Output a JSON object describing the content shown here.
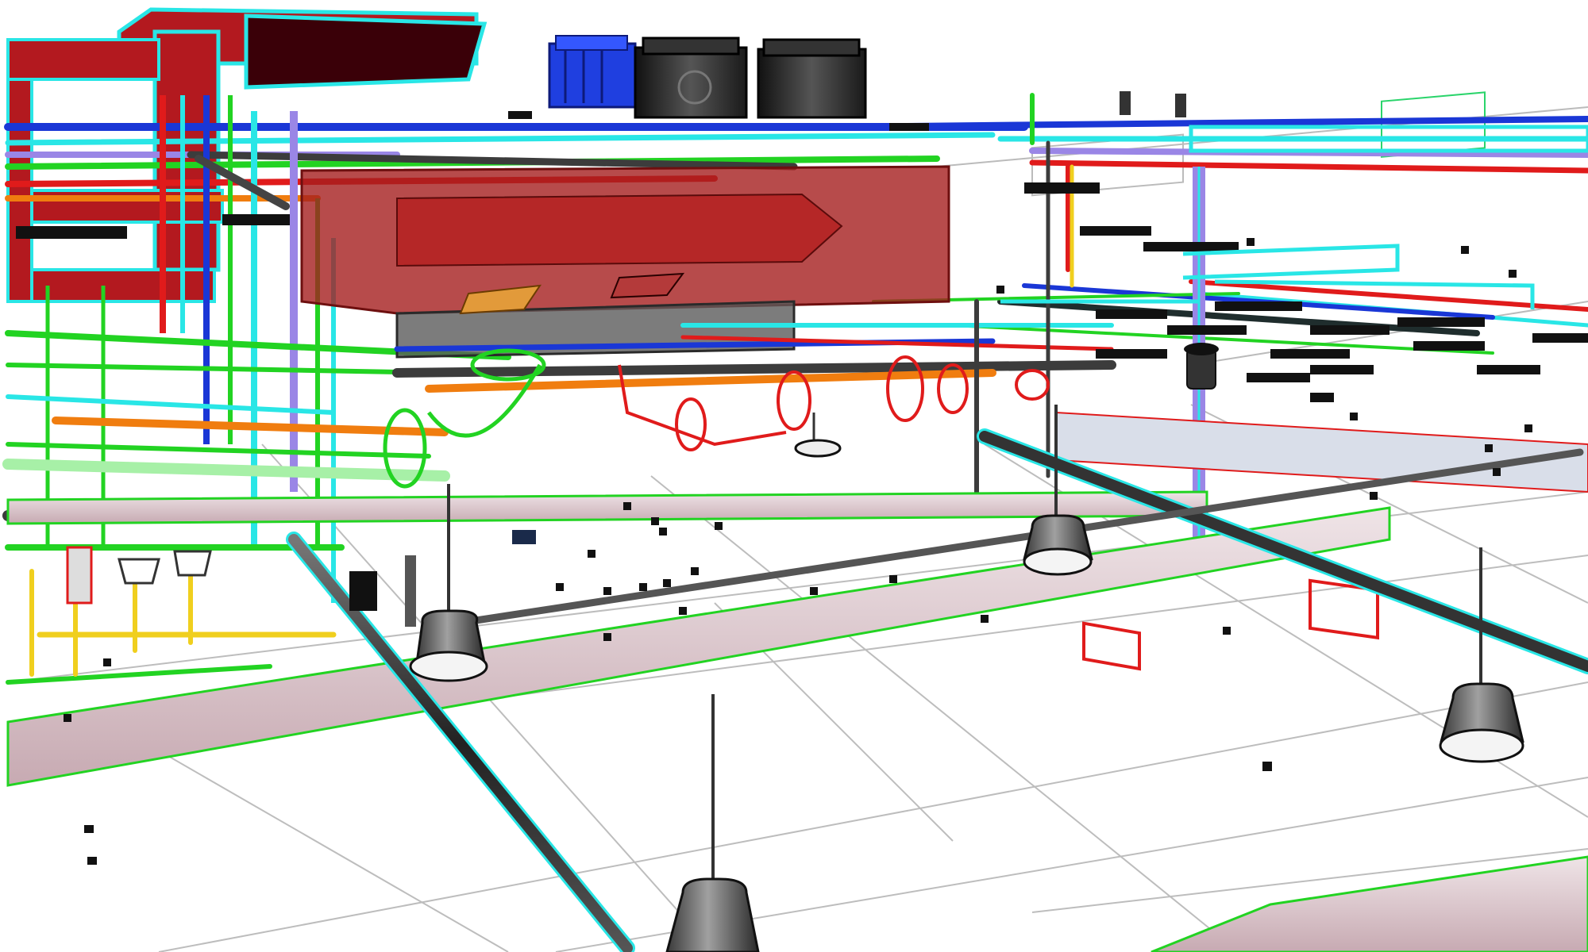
{
  "view": {
    "kind": "3d-mep-coordination-model",
    "background_color": "#ffffff",
    "labels_shown": false
  },
  "colors": {
    "supply_duct": "#b3191f",
    "supply_duct_translucent": "#a51e1e",
    "duct_outline": "#29e6e6",
    "chilled_water_pipe": "#1a37d6",
    "heating_water_pipe": "#e01b1b",
    "condensate_pipe": "#22d322",
    "gas_pipe": "#f0cf1e",
    "sprinkler_pipe": "#f07d0f",
    "purple_pipe": "#9a86e6",
    "dark_pipe": "#3c3c3c",
    "chiller": "#242424",
    "pump": "#1f3fe0",
    "cable_tray": "#d4b8bf",
    "ceiling_grid": "#bdbdbd",
    "light_fixture": "#5a5a5a"
  },
  "systems": [
    {
      "name": "supply-air-duct",
      "color_key": "supply_duct"
    },
    {
      "name": "chilled-water",
      "color_key": "chilled_water_pipe"
    },
    {
      "name": "heating-water",
      "color_key": "heating_water_pipe"
    },
    {
      "name": "condensate",
      "color_key": "condensate_pipe"
    },
    {
      "name": "gas",
      "color_key": "gas_pipe"
    },
    {
      "name": "fire-sprinkler",
      "color_key": "sprinkler_pipe"
    },
    {
      "name": "structural-pipe",
      "color_key": "dark_pipe"
    }
  ],
  "equipment": {
    "chillers": 2,
    "rooftop_pumps": 1,
    "pendant_light_fixtures": 5,
    "translucent_air_handler": 1,
    "pipe_fittings_red": 6,
    "hangers": 2
  }
}
